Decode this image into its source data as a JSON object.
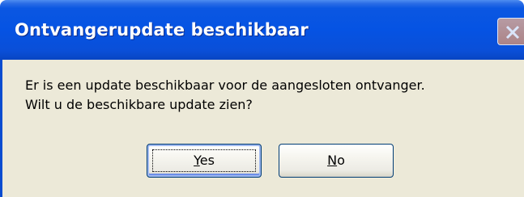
{
  "dialog": {
    "title": "Ontvangerupdate beschikbaar",
    "message_line1": "Er is een update beschikbaar voor de aangesloten ontvanger.",
    "message_line2": "Wilt u de beschikbare update zien?",
    "buttons": {
      "yes": {
        "mnemonic": "Y",
        "rest": "es"
      },
      "no": {
        "mnemonic": "N",
        "rest": "o"
      }
    },
    "icons": {
      "close": "close-x-icon"
    },
    "colors": {
      "titlebar": "#0553e3",
      "body": "#ece9d8",
      "button_border": "#003c74"
    }
  }
}
